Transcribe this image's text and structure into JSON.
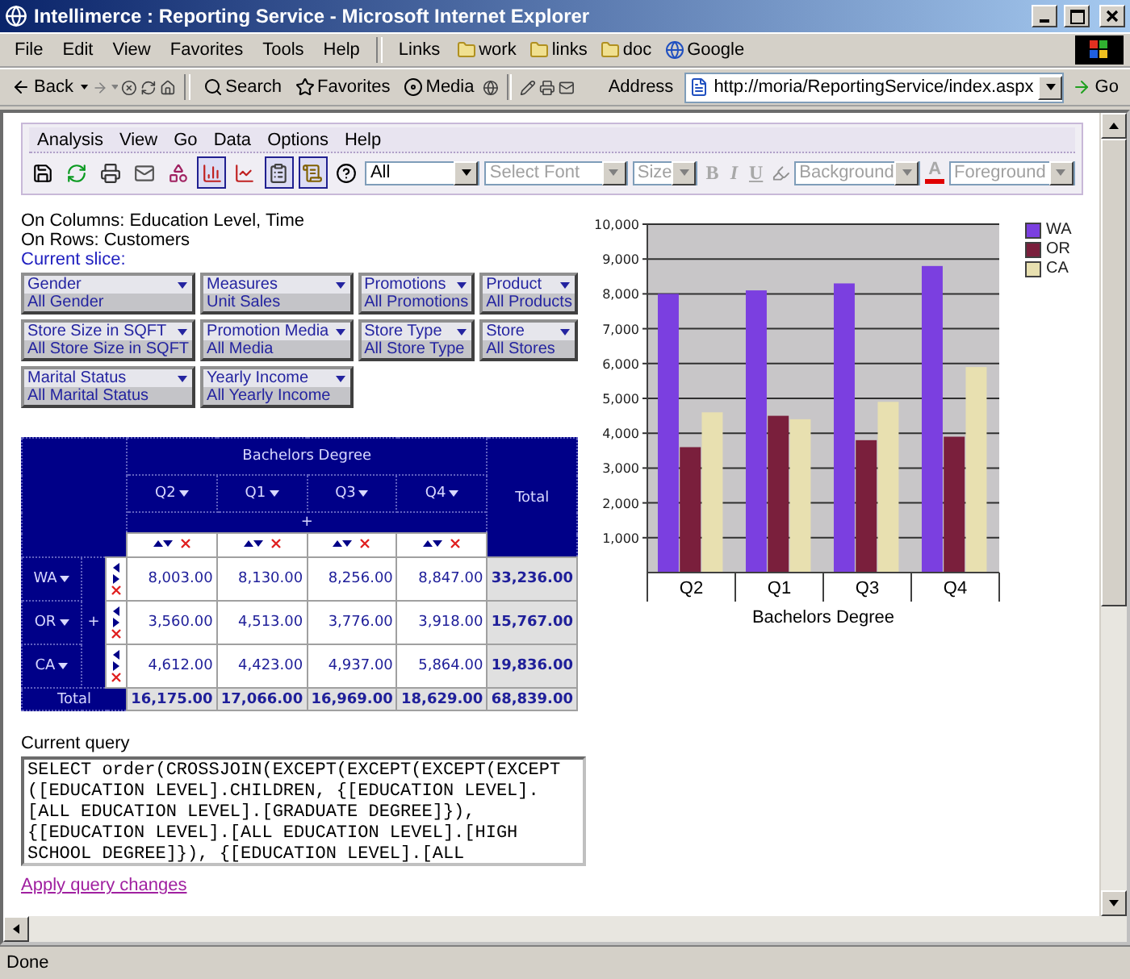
{
  "window": {
    "title": "Intellimerce : Reporting Service - Microsoft Internet Explorer"
  },
  "browser_menu": [
    "File",
    "Edit",
    "View",
    "Favorites",
    "Tools",
    "Help"
  ],
  "links": {
    "label": "Links",
    "items": [
      "work",
      "links",
      "doc",
      "Google"
    ]
  },
  "browser_toolbar": {
    "back": "Back",
    "search": "Search",
    "favorites": "Favorites",
    "media": "Media",
    "address_label": "Address",
    "address": "http://moria/ReportingService/index.aspx",
    "go": "Go"
  },
  "app_menu": [
    "Analysis",
    "View",
    "Go",
    "Data",
    "Options",
    "Help"
  ],
  "app_toolbar": {
    "buttons": [
      {
        "pressed": false
      },
      {
        "pressed": false
      },
      {
        "pressed": false
      },
      {
        "pressed": false
      },
      {
        "pressed": false
      },
      {
        "pressed": true
      },
      {
        "pressed": false
      },
      {
        "pressed": true
      },
      {
        "pressed": true
      },
      {
        "pressed": false
      }
    ],
    "filter": "All",
    "font": "Select Font",
    "size": "Size",
    "format_buttons": [
      "B",
      "I",
      "U"
    ],
    "background": "Background",
    "font_color": "A",
    "foreground": "Foreground",
    "formatting_disabled": true
  },
  "axes": {
    "columns": "On Columns: Education Level, Time",
    "rows": "On Rows: Customers",
    "slice_label": "Current slice:"
  },
  "slicers": [
    {
      "dimension": "Gender",
      "member": "All Gender"
    },
    {
      "dimension": "Measures",
      "member": "Unit Sales"
    },
    {
      "dimension": "Promotions",
      "member": "All Promotions"
    },
    {
      "dimension": "Product",
      "member": "All Products"
    },
    {
      "dimension": "Store Size in SQFT",
      "member": "All Store Size in SQFT"
    },
    {
      "dimension": "Promotion Media",
      "member": "All Media"
    },
    {
      "dimension": "Store Type",
      "member": "All Store Type"
    },
    {
      "dimension": "Store",
      "member": "All Stores"
    },
    {
      "dimension": "Marital Status",
      "member": "All Marital Status"
    },
    {
      "dimension": "Yearly Income",
      "member": "All Yearly Income"
    }
  ],
  "pivot": {
    "group_header": "Bachelors Degree",
    "columns": [
      "Q2",
      "Q1",
      "Q3",
      "Q4"
    ],
    "total_header": "Total",
    "column_expand": "+",
    "row_expand": "+",
    "rows": [
      {
        "label": "WA",
        "values": [
          "8,003.00",
          "8,130.00",
          "8,256.00",
          "8,847.00"
        ],
        "total": "33,236.00"
      },
      {
        "label": "OR",
        "values": [
          "3,560.00",
          "4,513.00",
          "3,776.00",
          "3,918.00"
        ],
        "total": "15,767.00"
      },
      {
        "label": "CA",
        "values": [
          "4,612.00",
          "4,423.00",
          "4,937.00",
          "5,864.00"
        ],
        "total": "19,836.00"
      }
    ],
    "totals": {
      "label": "Total",
      "values": [
        "16,175.00",
        "17,066.00",
        "16,969.00",
        "18,629.00"
      ],
      "total": "68,839.00"
    }
  },
  "chart": {
    "chart_data": {
      "type": "bar",
      "xlabel": "Bachelors Degree",
      "categories": [
        "Q2",
        "Q1",
        "Q3",
        "Q4"
      ],
      "series": [
        {
          "name": "WA",
          "color": "#7b3fe0",
          "values": [
            8000,
            8100,
            8300,
            8800
          ]
        },
        {
          "name": "OR",
          "color": "#7a1f3c",
          "values": [
            3600,
            4500,
            3800,
            3900
          ]
        },
        {
          "name": "CA",
          "color": "#e8e0b0",
          "values": [
            4600,
            4400,
            4900,
            5900
          ]
        }
      ],
      "grid": true,
      "ylim": [
        0,
        10000
      ],
      "yticks": [
        {
          "value": 1000,
          "label": "1,000"
        },
        {
          "value": 2000,
          "label": "2,000"
        },
        {
          "value": 3000,
          "label": "3,000"
        },
        {
          "value": 4000,
          "label": "4,000"
        },
        {
          "value": 5000,
          "label": "5,000"
        },
        {
          "value": 6000,
          "label": "6,000"
        },
        {
          "value": 7000,
          "label": "7,000"
        },
        {
          "value": 8000,
          "label": "8,000"
        },
        {
          "value": 9000,
          "label": "9,000"
        },
        {
          "value": 10000,
          "label": "10,000"
        }
      ]
    }
  },
  "query": {
    "label": "Current query",
    "value": "SELECT order(CROSSJOIN(EXCEPT(EXCEPT(EXCEPT(EXCEPT\n([EDUCATION LEVEL].CHILDREN, {[EDUCATION LEVEL].\n[ALL EDUCATION LEVEL].[GRADUATE DEGREE]}),\n{[EDUCATION LEVEL].[ALL EDUCATION LEVEL].[HIGH\nSCHOOL DEGREE]}), {[EDUCATION LEVEL].[ALL",
    "apply_link": "Apply query changes"
  },
  "status_bar": {
    "text": "Done"
  }
}
